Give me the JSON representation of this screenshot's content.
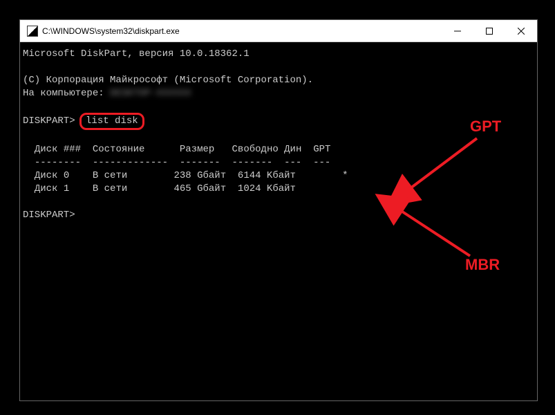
{
  "window": {
    "title": "C:\\WINDOWS\\system32\\diskpart.exe"
  },
  "terminal": {
    "header_line": "Microsoft DiskPart, версия 10.0.18362.1",
    "copyright": "(C) Корпорация Майкрософт (Microsoft Corporation).",
    "computer_label": "На компьютере: ",
    "computer_name_redacted": "DESKTOP-XXXXXX",
    "prompt": "DISKPART>",
    "command": "list disk",
    "table": {
      "headers": {
        "disk": "Диск ###",
        "status": "Состояние",
        "size": "Размер",
        "free": "Свободно",
        "dyn": "Дин",
        "gpt": "GPT"
      },
      "separator": "--------  -------------  -------  -------  ---  ---",
      "rows": [
        {
          "disk": "Диск 0",
          "status": "В сети",
          "size": "238 Gбайт",
          "free": "6144 Kбайт",
          "dyn": "",
          "gpt": "*"
        },
        {
          "disk": "Диск 1",
          "status": "В сети",
          "size": "465 Gбайт",
          "free": "1024 Kбайт",
          "dyn": "",
          "gpt": ""
        }
      ]
    }
  },
  "annotations": {
    "gpt_label": "GPT",
    "mbr_label": "MBR",
    "highlight_color": "#ed1c24"
  }
}
